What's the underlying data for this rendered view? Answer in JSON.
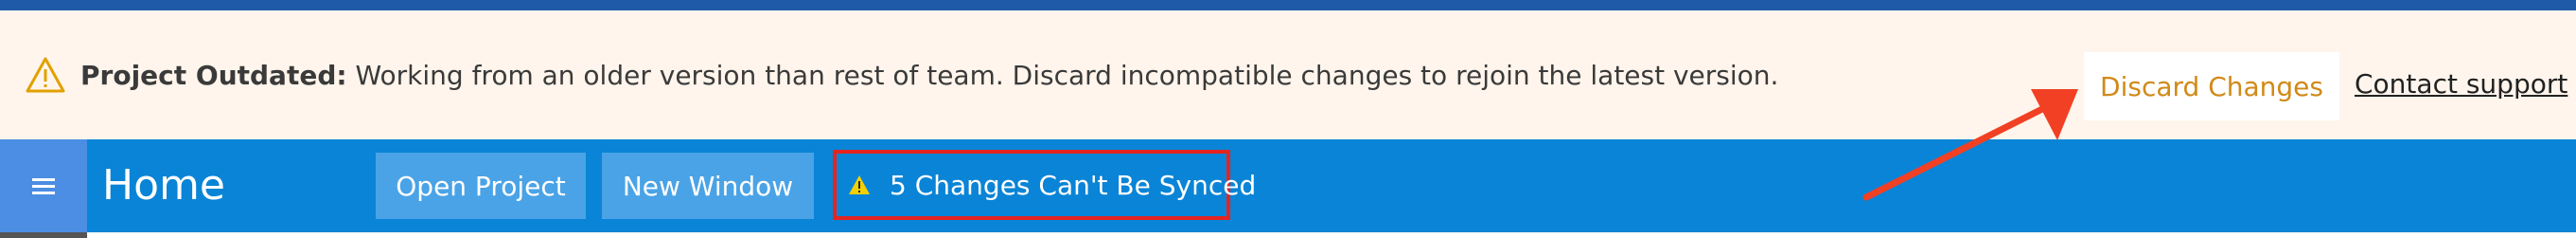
{
  "banner": {
    "title": "Project Outdated:",
    "message": " Working from an older version than rest of team. Discard incompatible changes to rejoin the latest version.",
    "discard_label": "Discard Changes",
    "contact_label": "Contact support",
    "icon": "warning-triangle-icon"
  },
  "navbar": {
    "menu_icon": "hamburger-icon",
    "title": "Home",
    "buttons": {
      "open_project": "Open Project",
      "new_window": "New Window"
    },
    "sync_warning": "5 Changes Can't Be Synced"
  },
  "colors": {
    "banner_bg": "#fff5ec",
    "navbar_bg": "#0a84d6",
    "discard_text": "#d08a18",
    "highlight_border": "#e52420",
    "arrow": "#f24024"
  }
}
